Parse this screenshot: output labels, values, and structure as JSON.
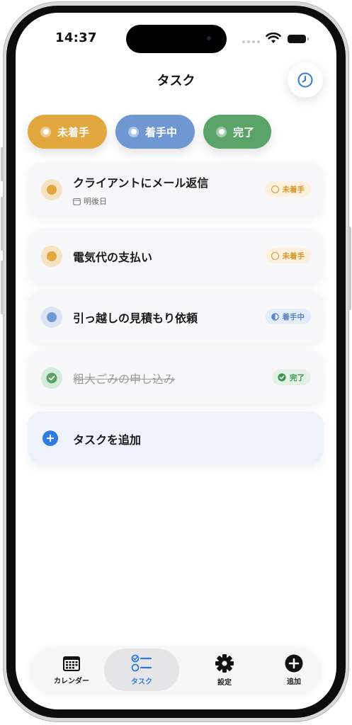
{
  "status_bar": {
    "time": "14:37"
  },
  "header": {
    "title": "タスク",
    "history_icon": "clock-icon"
  },
  "filters": [
    {
      "label": "未着手",
      "color": "#e2a73e"
    },
    {
      "label": "着手中",
      "color": "#6f98d2"
    },
    {
      "label": "完了",
      "color": "#5aa46a"
    }
  ],
  "tasks": [
    {
      "name": "クライアントにメール返信",
      "due": "明後日",
      "status": "未着手",
      "strikethrough": false
    },
    {
      "name": "電気代の支払い",
      "due": "",
      "status": "未着手",
      "strikethrough": false
    },
    {
      "name": "引っ越しの見積もり依頼",
      "due": "",
      "status": "着手中",
      "strikethrough": false
    },
    {
      "name": "粗大ごみの申し込み",
      "due": "",
      "status": "完了",
      "strikethrough": true
    }
  ],
  "add_task": {
    "label": "タスクを追加"
  },
  "tabbar": {
    "items": [
      {
        "label": "カレンダー",
        "icon": "calendar-icon",
        "active": false
      },
      {
        "label": "タスク",
        "icon": "checklist-icon",
        "active": true
      },
      {
        "label": "設定",
        "icon": "gear-icon",
        "active": false
      },
      {
        "label": "追加",
        "icon": "plus-circle-icon",
        "active": false
      }
    ]
  },
  "colors": {
    "accent": "#2f7be0",
    "todo": "#e2a73e",
    "doing": "#6f98d2",
    "done": "#5aa46a"
  }
}
